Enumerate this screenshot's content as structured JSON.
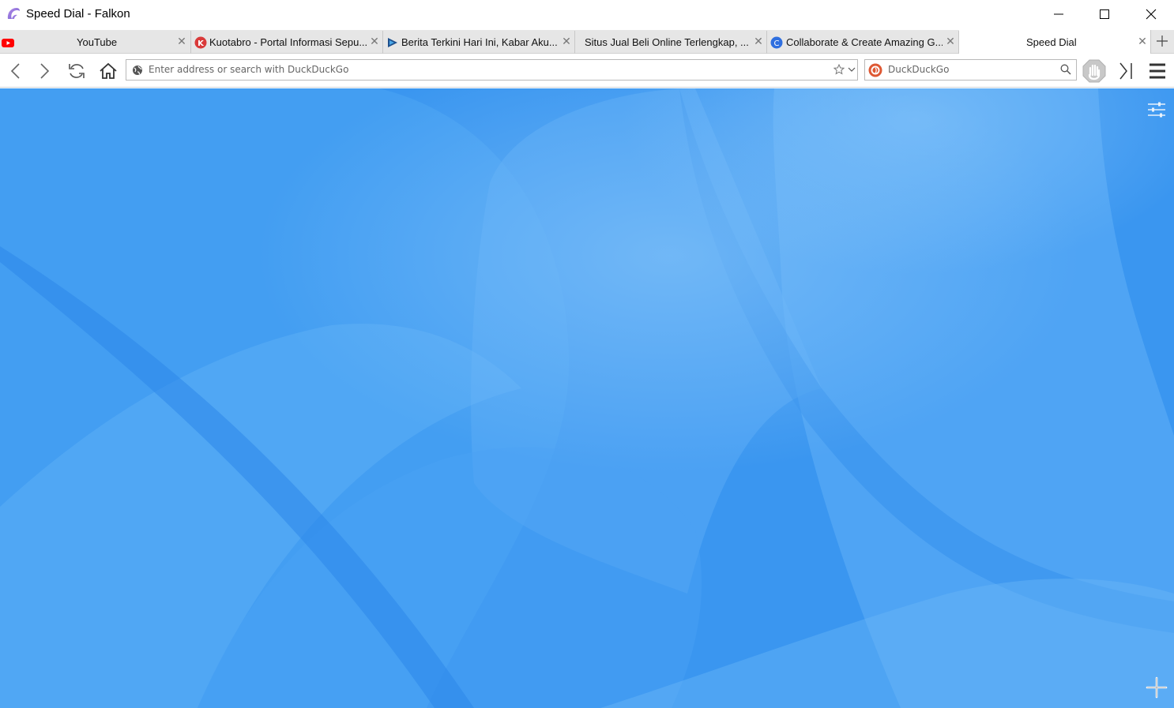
{
  "window": {
    "title": "Speed Dial - Falkon",
    "app_icon": "falkon-logo-icon",
    "controls": [
      "minimize-icon",
      "maximize-icon",
      "close-icon"
    ]
  },
  "tabs": [
    {
      "title": "YouTube",
      "favicon": "youtube-icon",
      "active": false
    },
    {
      "title": "Kuotabro - Portal Informasi Sepu...",
      "favicon": "kuotabro-icon",
      "active": false
    },
    {
      "title": "Berita Terkini Hari Ini, Kabar Aku...",
      "favicon": "news-icon",
      "active": false
    },
    {
      "title": "Situs Jual Beli Online Terlengkap, ...",
      "favicon": "",
      "active": false
    },
    {
      "title": "Collaborate & Create Amazing G...",
      "favicon": "canva-icon",
      "active": false
    },
    {
      "title": "Speed Dial",
      "favicon": "",
      "active": true
    }
  ],
  "toolbar": {
    "address_placeholder": "Enter address or search with DuckDuckGo",
    "search_placeholder": "DuckDuckGo",
    "buttons": [
      "back-icon",
      "forward-icon",
      "reload-icon",
      "home-icon",
      "adblock-icon",
      "sidebar-toggle-icon",
      "menu-icon"
    ]
  },
  "colors": {
    "content_blue": "#3a98f2",
    "youtube_red": "#ff0000",
    "kuotabro_red": "#d93a3a",
    "canva_blue": "#2f6fdf",
    "duckduckgo_orange": "#de5833"
  }
}
